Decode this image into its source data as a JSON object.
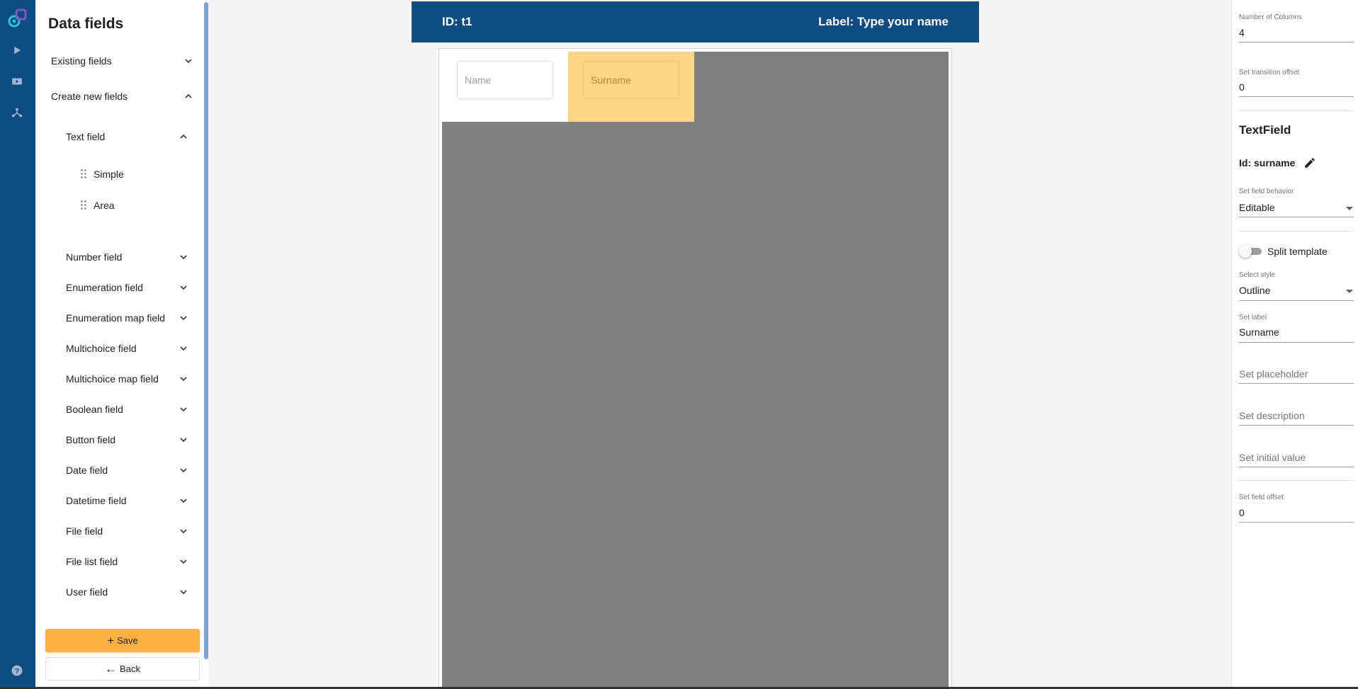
{
  "rail": {
    "icons": [
      "app-logo",
      "play-icon",
      "youtube-icon",
      "network-icon",
      "help-icon"
    ]
  },
  "fields_panel": {
    "title": "Data fields",
    "existing": "Existing fields",
    "create_new": "Create new fields",
    "text_field": "Text field",
    "text_items": [
      "Simple",
      "Area"
    ],
    "types": [
      "Number field",
      "Enumeration field",
      "Enumeration map field",
      "Multichoice field",
      "Multichoice map field",
      "Boolean field",
      "Button field",
      "Date field",
      "Datetime field",
      "File field",
      "File list field",
      "User field"
    ],
    "save": "Save",
    "back": "Back"
  },
  "canvas": {
    "header_id": "ID: t1",
    "header_label": "Label: Type your name",
    "field_name_placeholder": "Name",
    "field_surname_placeholder": "Surname"
  },
  "props": {
    "columns_label": "Number of Columns",
    "columns_value": "4",
    "transition_label": "Set transition offset",
    "transition_value": "0",
    "type_title": "TextField",
    "id_text": "Id: surname",
    "behavior_label": "Set field behavior",
    "behavior_value": "Editable",
    "split_label": "Split template",
    "style_label": "Select style",
    "style_value": "Outline",
    "label_label": "Set label",
    "label_value": "Surname",
    "placeholder_ph": "Set placeholder",
    "description_ph": "Set description",
    "initial_ph": "Set initial value",
    "offset_label": "Set field offset",
    "offset_value": "0"
  },
  "colors": {
    "primary": "#0f4c81",
    "accent": "#fdb145",
    "selected_cell": "#ffd485",
    "canvas_grey": "#808080"
  }
}
